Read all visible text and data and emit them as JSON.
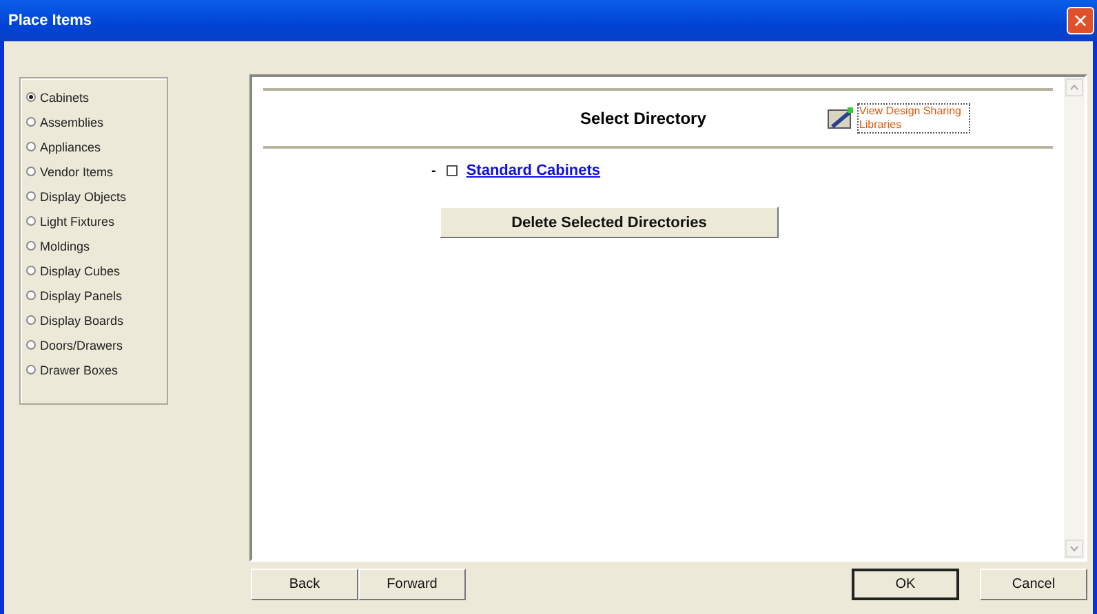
{
  "window": {
    "title": "Place Items",
    "close": "×"
  },
  "categories": [
    {
      "label": "Cabinets",
      "selected": true
    },
    {
      "label": "Assemblies",
      "selected": false
    },
    {
      "label": "Appliances",
      "selected": false
    },
    {
      "label": "Vendor Items",
      "selected": false
    },
    {
      "label": "Display Objects",
      "selected": false
    },
    {
      "label": "Light Fixtures",
      "selected": false
    },
    {
      "label": "Moldings",
      "selected": false
    },
    {
      "label": "Display Cubes",
      "selected": false
    },
    {
      "label": "Display Panels",
      "selected": false
    },
    {
      "label": "Display Boards",
      "selected": false
    },
    {
      "label": "Doors/Drawers",
      "selected": false
    },
    {
      "label": "Drawer Boxes",
      "selected": false
    }
  ],
  "content": {
    "heading": "Select Directory",
    "link": "View Design Sharing Libraries",
    "tree": [
      {
        "label": "Standard Cabinets",
        "checked": false,
        "expander": "-"
      }
    ],
    "delete_button": "Delete Selected Directories"
  },
  "nav_buttons": [
    "Back",
    "Forward"
  ],
  "dialog_buttons": [
    "OK",
    "Cancel"
  ]
}
